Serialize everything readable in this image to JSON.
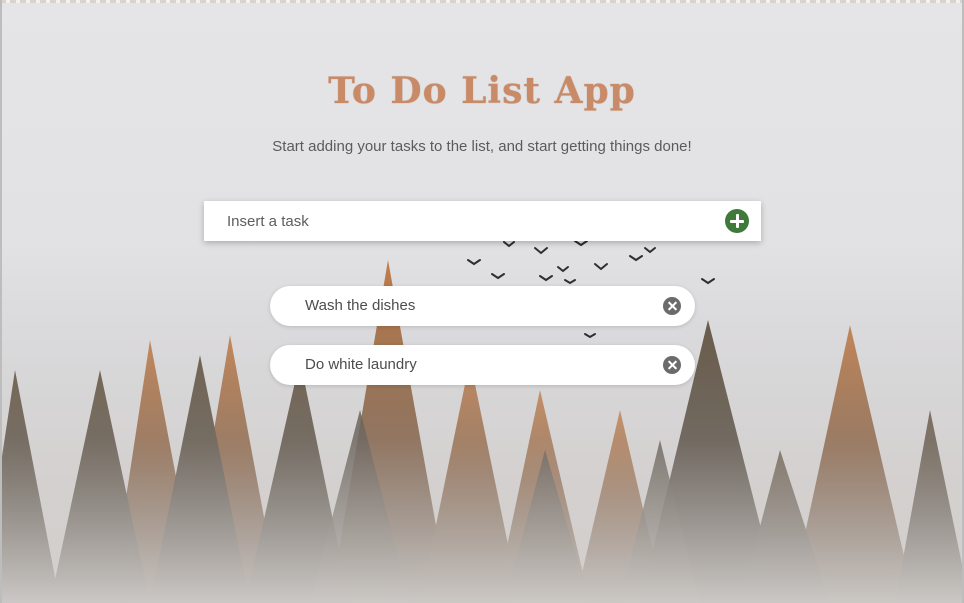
{
  "app": {
    "title": "To Do List App",
    "subtitle": "Start adding your tasks to the list, and start getting things done!"
  },
  "input": {
    "placeholder": "Insert a task",
    "value": "",
    "add_icon": "plus-circle-icon",
    "add_color": "#3f7a3a"
  },
  "tasks": [
    {
      "text": "Wash the dishes",
      "remove_icon": "close-circle-icon"
    },
    {
      "text": "Do white laundry",
      "remove_icon": "close-circle-icon"
    }
  ],
  "colors": {
    "title": "#c98a67",
    "subtitle": "#5b5b5b",
    "background_sky": "#e4e4e6",
    "remove_button": "#6b6b6b"
  }
}
